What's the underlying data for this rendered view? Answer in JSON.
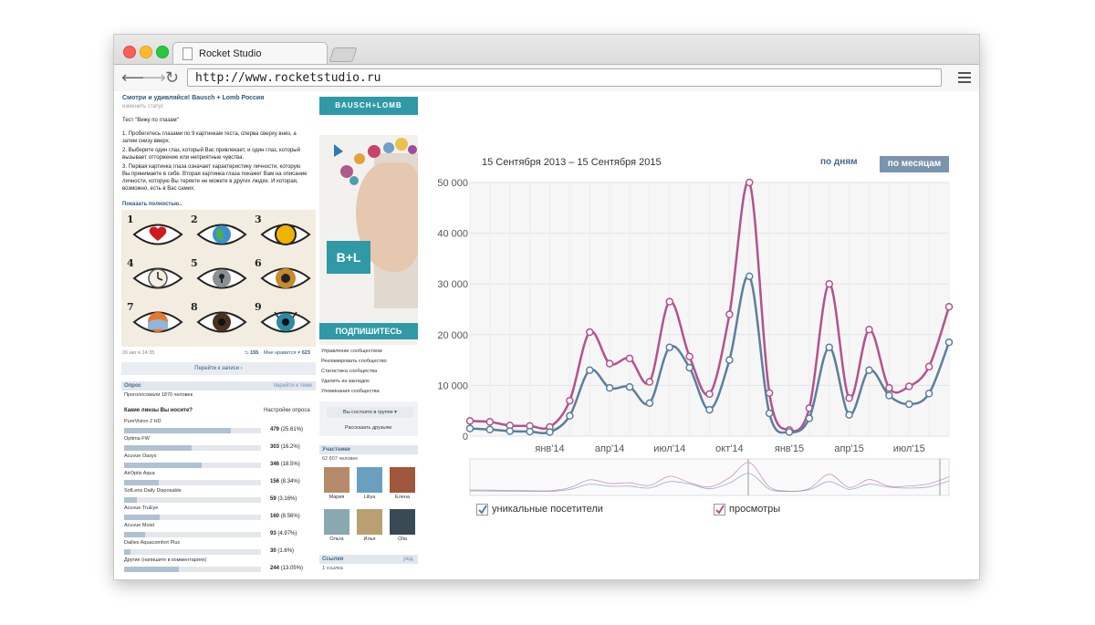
{
  "browser": {
    "tab_title": "Rocket Studio",
    "url": "http://www.rocketstudio.ru",
    "back_glyph": "⟵",
    "forward_glyph": "⟶",
    "reload_glyph": "↻"
  },
  "post": {
    "title": "Смотри и удивляйся! Bausch + Lomb Россия",
    "subtitle": "изменить статус",
    "test_name": "Тест \"Вижу по глазам\"",
    "paragraphs": [
      "1. Пробегитесь глазами по 9 картинкам теста, сперва сверху вниз, а затем снизу вверх.",
      "2. Выберите один глаз, который Вас привлекает, и один глаз, который вызывает отторжение или неприятные чувства.",
      "3. Первая картинка глаза означает характеристику личности, которую Вы принимаете в себе. Вторая картинка глаза покажет Вам на описание личности, которую Вы теряете не можете в других людях. И которая, возможно, есть в Вас самих."
    ],
    "show_more": "Показать полностью..",
    "eye_numbers": [
      "1",
      "2",
      "3",
      "4",
      "5",
      "6",
      "7",
      "8",
      "9"
    ],
    "date": "26 авг в 14:35",
    "reposts": "155",
    "likes_label": "Мне нравится",
    "likes": "623",
    "goto_post": "Перейти к записи ›"
  },
  "poll": {
    "head_label": "Опрос",
    "head_link": "перейти к теме",
    "voted": "Проголосовали 1870 человек",
    "question": "Какие линзы Вы носите?",
    "settings": "Настройки опроса",
    "items": [
      {
        "label": "PureVision 2 HD",
        "count": "479",
        "pct": "(25.61%)",
        "fraction": 0.2561
      },
      {
        "label": "Optima FW",
        "count": "303",
        "pct": "(16.2%)",
        "fraction": 0.162
      },
      {
        "label": "Acuvue Oasys",
        "count": "346",
        "pct": "(18.5%)",
        "fraction": 0.185
      },
      {
        "label": "AirOptix Aqua",
        "count": "156",
        "pct": "(8.34%)",
        "fraction": 0.0834
      },
      {
        "label": "SofLens Daily Disposable",
        "count": "59",
        "pct": "(3.16%)",
        "fraction": 0.0316
      },
      {
        "label": "Acuvue TruEye",
        "count": "160",
        "pct": "(8.56%)",
        "fraction": 0.0856
      },
      {
        "label": "Acuvue Moist",
        "count": "93",
        "pct": "(4.97%)",
        "fraction": 0.0497
      },
      {
        "label": "Dailies Aquacomfort Plus",
        "count": "30",
        "pct": "(1.6%)",
        "fraction": 0.016
      },
      {
        "label": "Другие (напишите в комментариях)",
        "count": "244",
        "pct": "(13.05%)",
        "fraction": 0.1305
      }
    ]
  },
  "sidebar": {
    "brand": "BAUSCH+LOMB",
    "ad_logo": "B+L",
    "ad_cta": "ПОДПИШИТЕСЬ",
    "links": [
      "Управление сообществом",
      "Рекламировать сообщество",
      "Статистика сообщества",
      "Удалить из закладок",
      "Упоминания сообщества"
    ],
    "in_group_btn": "Вы состоите в группе ▾",
    "tell_friends": "Рассказать друзьям",
    "members_head": "Участники",
    "members_count": "62 807 человек",
    "members": [
      "Мария",
      "Liliya",
      "Елена",
      "Ольга",
      "Илья",
      "Olia"
    ],
    "member_colors": [
      "#b58a6a",
      "#6a9fbf",
      "#a0563a",
      "#8aa8b0",
      "#b8a070",
      "#3a4a55"
    ],
    "links_head": "Ссылки",
    "links_head_right": "ред.",
    "links_count": "1 ссылка"
  },
  "chart_header": {
    "range": "15 Сентября 2013 – 15 Сентября 2015",
    "by_days": "по дням",
    "by_months": "по месяцам"
  },
  "chart_data": {
    "type": "line",
    "x": [
      "2013-09",
      "2013-10",
      "2013-11",
      "2013-12",
      "2014-01",
      "2014-02",
      "2014-03",
      "2014-04",
      "2014-05",
      "2014-06",
      "2014-07",
      "2014-08",
      "2014-09",
      "2014-10",
      "2014-11",
      "2014-12",
      "2015-01",
      "2015-02",
      "2015-03",
      "2015-04",
      "2015-05",
      "2015-06",
      "2015-07",
      "2015-08",
      "2015-09"
    ],
    "x_tick_labels": [
      "янв'14",
      "апр'14",
      "июл'14",
      "окт'14",
      "янв'15",
      "апр'15",
      "июл'15"
    ],
    "x_tick_positions": [
      "2014-01",
      "2014-04",
      "2014-07",
      "2014-10",
      "2015-01",
      "2015-04",
      "2015-07"
    ],
    "y_ticks": [
      "0",
      "10 000",
      "20 000",
      "30 000",
      "40 000",
      "50 000"
    ],
    "ylim": [
      0,
      50000
    ],
    "grid": true,
    "series": [
      {
        "name": "уникальные посетители",
        "color": "#5b7f9c",
        "values": [
          1500,
          1300,
          1000,
          900,
          800,
          4000,
          13000,
          9500,
          9700,
          6500,
          17500,
          13500,
          5200,
          15000,
          31500,
          4500,
          800,
          3500,
          17500,
          4200,
          13000,
          8000,
          6300,
          8400,
          18500
        ]
      },
      {
        "name": "просмотры",
        "color": "#b3528e",
        "values": [
          3000,
          2800,
          2100,
          2000,
          1800,
          7000,
          20500,
          14300,
          15300,
          10700,
          26500,
          15700,
          8300,
          24000,
          50000,
          8500,
          1200,
          5500,
          30000,
          7500,
          21000,
          9500,
          9800,
          13700,
          25500
        ]
      }
    ],
    "legend": [
      "уникальные посетители",
      "просмотры"
    ],
    "legend_position": "bottom"
  }
}
